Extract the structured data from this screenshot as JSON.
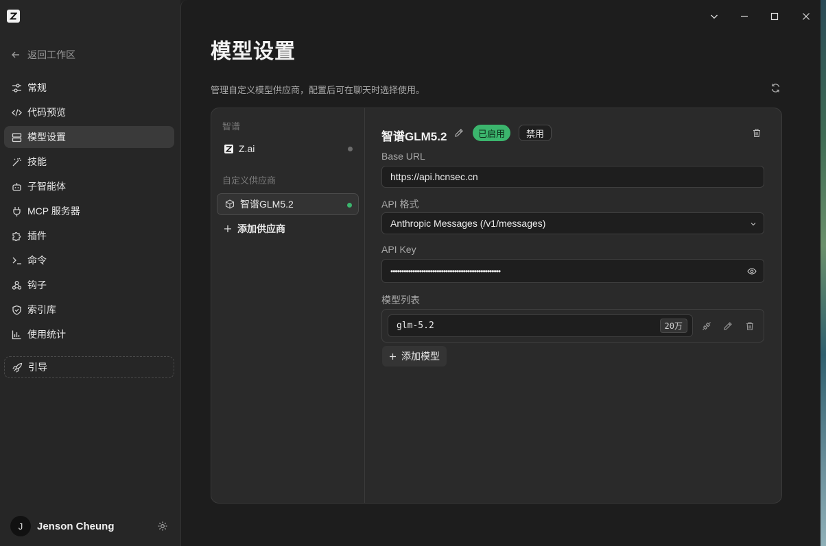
{
  "window": {
    "logo_letter": "Z",
    "controls": [
      "chevron-down-icon",
      "minimize-icon",
      "maximize-icon",
      "close-icon"
    ]
  },
  "sidebar": {
    "back_label": "返回工作区",
    "items": [
      {
        "label": "常规",
        "icon": "sliders-icon",
        "active": false
      },
      {
        "label": "代码预览",
        "icon": "code-icon",
        "active": false
      },
      {
        "label": "模型设置",
        "icon": "server-icon",
        "active": true
      },
      {
        "label": "技能",
        "icon": "magic-wand-icon",
        "active": false
      },
      {
        "label": "子智能体",
        "icon": "bot-icon",
        "active": false
      },
      {
        "label": "MCP 服务器",
        "icon": "plug-icon",
        "active": false
      },
      {
        "label": "插件",
        "icon": "puzzle-icon",
        "active": false
      },
      {
        "label": "命令",
        "icon": "terminal-icon",
        "active": false
      },
      {
        "label": "钩子",
        "icon": "webhook-icon",
        "active": false
      },
      {
        "label": "索引库",
        "icon": "shield-icon",
        "active": false
      },
      {
        "label": "使用统计",
        "icon": "bar-chart-icon",
        "active": false
      }
    ],
    "guide_label": "引导",
    "user": {
      "initial": "J",
      "name": "Jenson Cheung"
    }
  },
  "main": {
    "title": "模型设置",
    "description": "管理自定义模型供应商，配置后可在聊天时选择使用。"
  },
  "providers": {
    "group_builtin": "智谱",
    "builtin": [
      {
        "name": "Z.ai",
        "status_color": "#6b6b6b"
      }
    ],
    "group_custom": "自定义供应商",
    "custom": [
      {
        "name": "智谱GLM5.2",
        "status_color": "#3bb56d",
        "selected": true
      }
    ],
    "add_label": "添加供应商"
  },
  "detail": {
    "name": "智谱GLM5.2",
    "enabled_label": "已启用",
    "disable_label": "禁用",
    "base_url_label": "Base URL",
    "base_url": "https://api.hcnsec.cn",
    "api_format_label": "API 格式",
    "api_format": "Anthropic Messages (/v1/messages)",
    "api_key_label": "API Key",
    "api_key_masked": "••••••••••••••••••••••••••••••••••••••••••••••••••",
    "models_label": "模型列表",
    "models": [
      {
        "id": "glm-5.2",
        "context": "20万"
      }
    ],
    "add_model_label": "添加模型"
  },
  "colors": {
    "accent_green": "#3bb56d",
    "background": "#1d1d1d",
    "sidebar": "#262626",
    "panel": "#2a2a2a"
  }
}
